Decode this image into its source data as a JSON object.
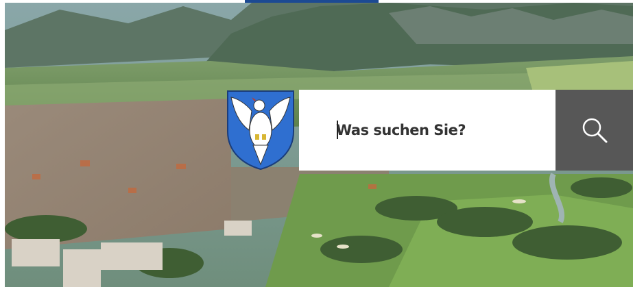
{
  "search": {
    "placeholder": "Was suchen Sie?",
    "button_icon": "search-icon"
  },
  "crest": {
    "icon": "coat-of-arms-icon",
    "colors": {
      "shield": "#2f6fd0",
      "bird": "#ffffff",
      "accent": "#d8b633",
      "beak": "#c0392b"
    }
  },
  "colors": {
    "top_tab": "#1c4a93",
    "search_button": "#575757",
    "search_box": "#ffffff"
  }
}
